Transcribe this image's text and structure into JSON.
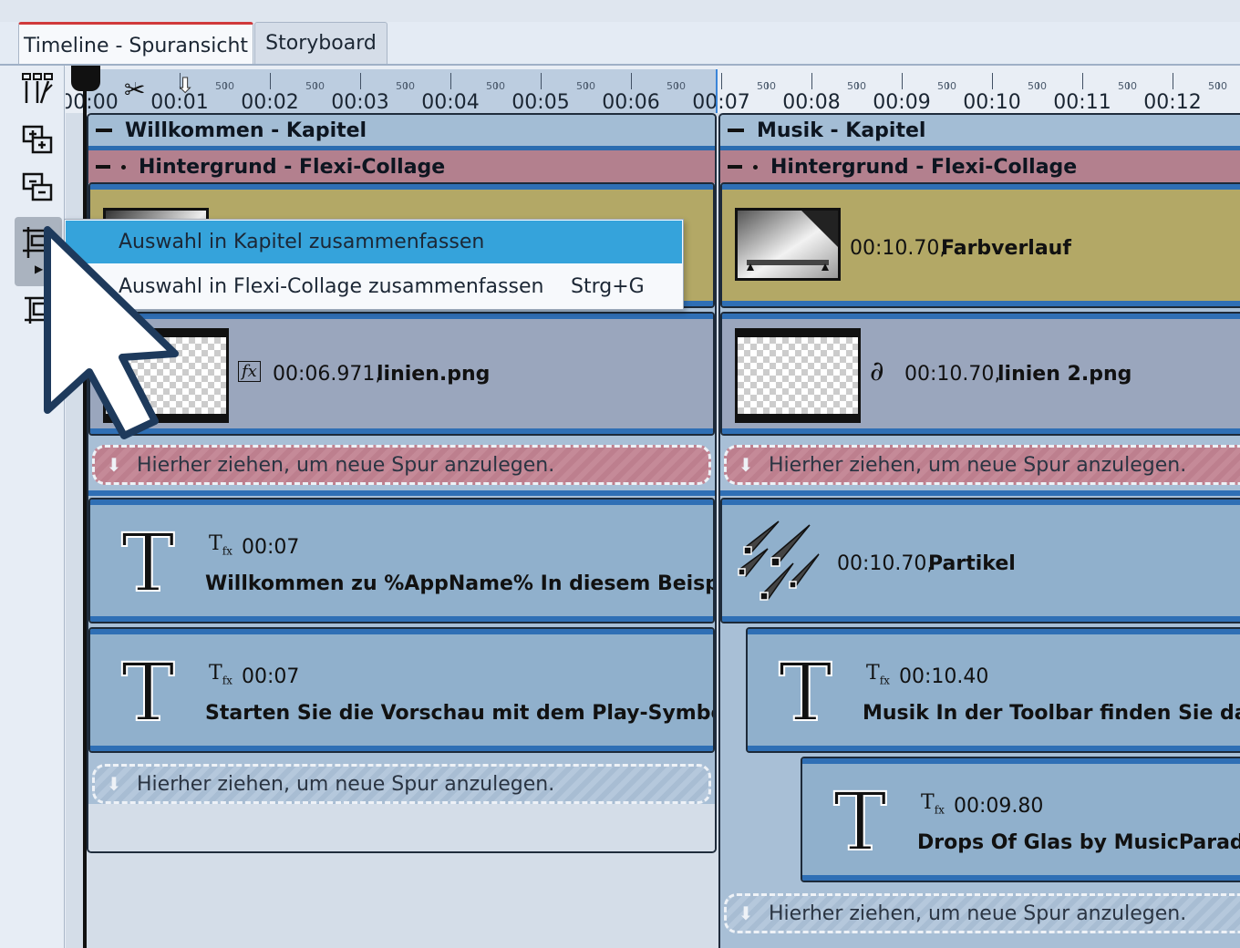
{
  "tabs": [
    {
      "label": "Timeline - Spuransicht",
      "active": true
    },
    {
      "label": "Storyboard",
      "active": false
    }
  ],
  "ruler": {
    "labels": [
      "00:00",
      "00:01",
      "00:02",
      "00:03",
      "00:04",
      "00:05",
      "00:06",
      "00:07",
      "00:08",
      "00:09",
      "00:10",
      "00:11",
      "00:12"
    ],
    "minor_label": "500"
  },
  "chapters": [
    {
      "title": "Willkommen - Kapitel",
      "collage": "Hintergrund - Flexi-Collage",
      "image_track": {
        "duration": "00:06.971,",
        "name": "linien.png"
      },
      "drop_collage": "Hierher ziehen, um neue Spur anzulegen.",
      "text_tracks": [
        {
          "duration": "00:07",
          "text": "Willkommen zu %AppName% In diesem Beispiel sehen"
        },
        {
          "duration": "00:07",
          "text": "Starten Sie die Vorschau mit dem Play-Symbol oder"
        }
      ],
      "drop_chapter": "Hierher ziehen, um neue Spur anzulegen."
    },
    {
      "title": "Musik - Kapitel",
      "collage": "Hintergrund - Flexi-Collage",
      "gradient_track": {
        "duration": "00:10.70,",
        "name": "Farbverlauf"
      },
      "image_track": {
        "duration": "00:10.70,",
        "name": "linien 2.png"
      },
      "drop_collage": "Hierher ziehen, um neue Spur anzulegen.",
      "particle_track": {
        "duration": "00:10.70,",
        "name": "Partikel"
      },
      "text_tracks": [
        {
          "duration": "00:10.40",
          "text": "Musik In der Toolbar finden Sie das Musik"
        },
        {
          "duration": "00:09.80",
          "text": "Drops Of Glas by MusicParadise Lounge"
        }
      ],
      "drop_chapter": "Hierher ziehen, um neue Spur anzulegen."
    }
  ],
  "context_menu": {
    "items": [
      {
        "label": "Auswahl in Kapitel zusammenfassen",
        "shortcut": "",
        "highlighted": true
      },
      {
        "label": "Auswahl in Flexi-Collage zusammenfassen",
        "shortcut": "Strg+G",
        "highlighted": false
      }
    ]
  },
  "toolbar": {
    "icons": [
      "split-tool-icon",
      "add-track-icon",
      "remove-track-icon",
      "group-icon",
      "ungroup-icon"
    ]
  },
  "colors": {
    "accent": "#35a3db",
    "chapter": "#a8bfd6",
    "collage": "#b3808e",
    "gradient_track": "#b3a866",
    "image_track": "#9aa6bd",
    "text_track": "#90b0cc",
    "track_bar": "#2f6fb5"
  }
}
